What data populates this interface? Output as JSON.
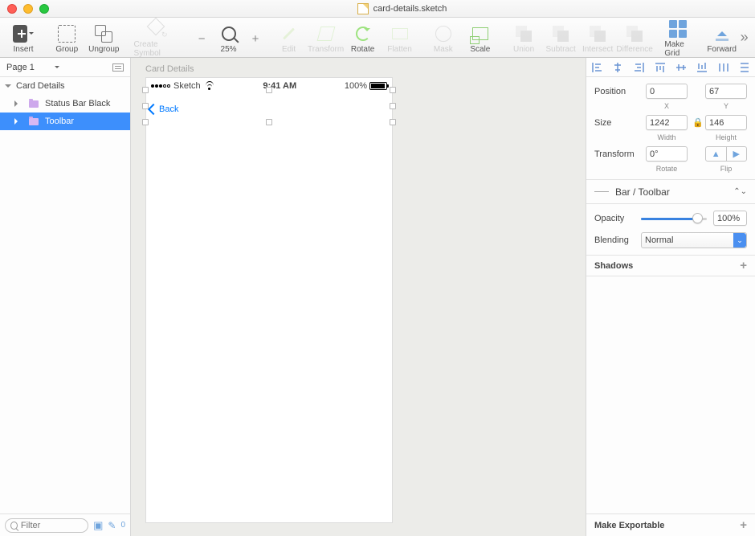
{
  "window": {
    "filename": "card-details.sketch"
  },
  "toolbar": {
    "insert": "Insert",
    "group": "Group",
    "ungroup": "Ungroup",
    "create_symbol": "Create Symbol",
    "zoom_pct": "25%",
    "edit": "Edit",
    "transform": "Transform",
    "rotate": "Rotate",
    "flatten": "Flatten",
    "mask": "Mask",
    "scale": "Scale",
    "union": "Union",
    "subtract": "Subtract",
    "intersect": "Intersect",
    "difference": "Difference",
    "make_grid": "Make Grid",
    "forward": "Forward"
  },
  "sidebar": {
    "page": "Page 1",
    "artboard": "Card Details",
    "layers": [
      {
        "name": "Status Bar Black"
      },
      {
        "name": "Toolbar"
      }
    ],
    "filter_placeholder": "Filter",
    "slice_count": "0"
  },
  "canvas": {
    "artboard_label": "Card Details",
    "statusbar": {
      "carrier": "Sketch",
      "time": "9:41 AM",
      "battery_pct": "100%"
    },
    "nav": {
      "back": "Back"
    }
  },
  "inspector": {
    "position_label": "Position",
    "pos_x": "0",
    "pos_y": "67",
    "sub_x": "X",
    "sub_y": "Y",
    "size_label": "Size",
    "width": "1242",
    "height": "146",
    "sub_w": "Width",
    "sub_h": "Height",
    "transform_label": "Transform",
    "rotate_val": "0°",
    "sub_rotate": "Rotate",
    "sub_flip": "Flip",
    "symbol_name": "Bar / Toolbar",
    "opacity_label": "Opacity",
    "opacity_val": "100%",
    "blending_label": "Blending",
    "blending_val": "Normal",
    "shadows_label": "Shadows",
    "export_label": "Make Exportable"
  }
}
